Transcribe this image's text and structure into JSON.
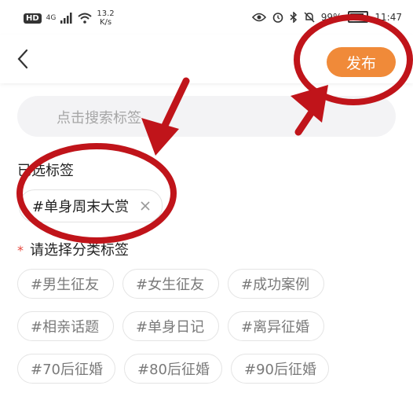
{
  "status_bar": {
    "hd": "HD",
    "signal": "4G",
    "speed_value": "13.2",
    "speed_unit": "K/s",
    "battery": "99%",
    "time": "11:47"
  },
  "header": {
    "publish_label": "发布"
  },
  "search": {
    "placeholder": "点击搜索标签"
  },
  "selected": {
    "label": "已选标签",
    "tags": [
      "#单身周末大赏"
    ]
  },
  "categories": {
    "required_mark": "*",
    "label": "请选择分类标签",
    "tags": [
      "#男生征友",
      "#女生征友",
      "#成功案例",
      "#相亲话题",
      "#单身日记",
      "#离异征婚",
      "#70后征婚",
      "#80后征婚",
      "#90后征婚"
    ]
  },
  "colors": {
    "accent": "#f08a39",
    "annotation": "#c0141a"
  }
}
